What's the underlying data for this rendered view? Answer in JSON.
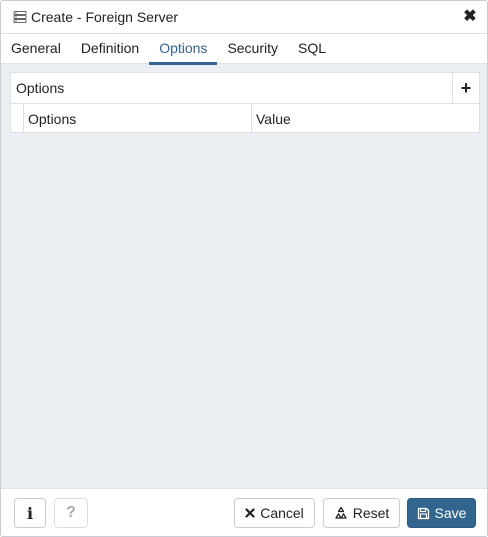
{
  "dialog": {
    "title": "Create - Foreign Server",
    "close_icon": "close-icon",
    "title_icon": "foreign-server-icon"
  },
  "tabs": [
    {
      "label": "General",
      "active": false
    },
    {
      "label": "Definition",
      "active": false
    },
    {
      "label": "Options",
      "active": true
    },
    {
      "label": "Security",
      "active": false
    },
    {
      "label": "SQL",
      "active": false
    }
  ],
  "options_panel": {
    "label": "Options",
    "add_symbol": "+",
    "columns": [
      "Options",
      "Value"
    ],
    "rows": []
  },
  "footer": {
    "info_label": "i",
    "help_label": "?",
    "cancel_label": "Cancel",
    "reset_label": "Reset",
    "save_label": "Save"
  },
  "colors": {
    "accent": "#326690",
    "background": "#ebeef3"
  }
}
